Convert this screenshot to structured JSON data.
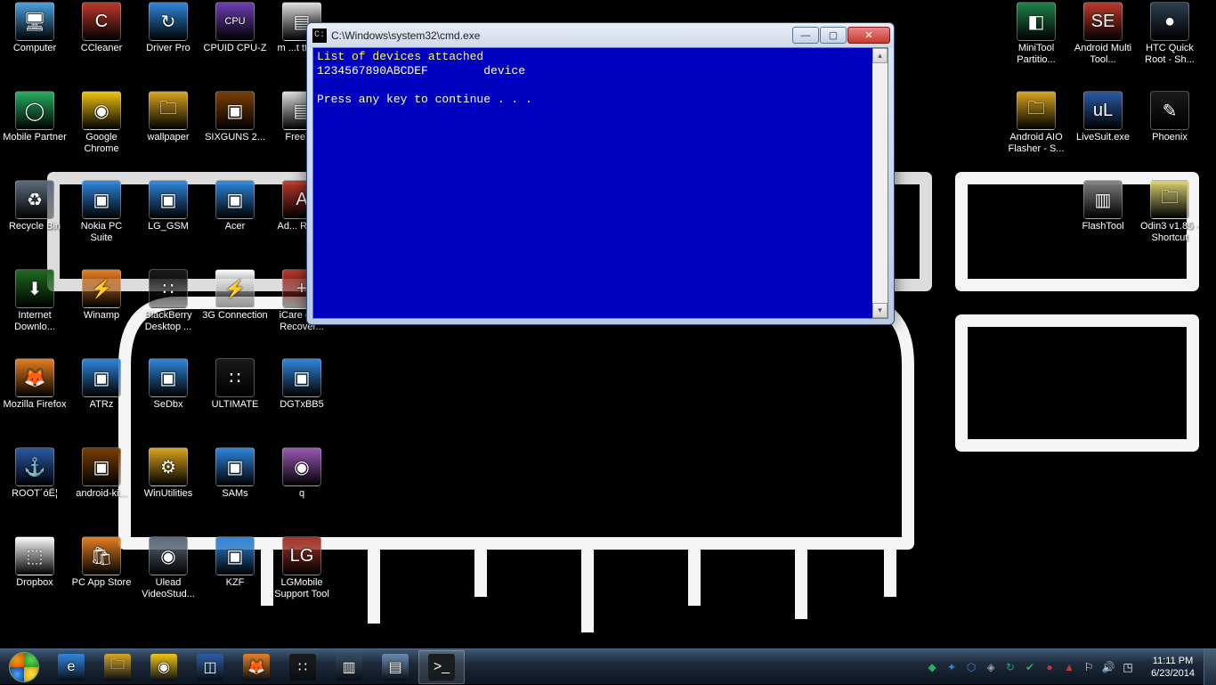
{
  "cmd": {
    "title": "C:\\Windows\\system32\\cmd.exe",
    "line1": "List of devices attached",
    "line2": "1234567890ABCDEF        device",
    "line3": "",
    "line4": "Press any key to continue . . ."
  },
  "desktop_icons": [
    {
      "label": "Computer",
      "glyph": "🖥",
      "col": 0,
      "row": 0,
      "bg": "#4aa3df"
    },
    {
      "label": "CCleaner",
      "glyph": "C",
      "col": 1,
      "row": 0,
      "bg": "#c0392b"
    },
    {
      "label": "Driver Pro",
      "glyph": "↻",
      "col": 2,
      "row": 0,
      "bg": "#2e86de"
    },
    {
      "label": "CPUID CPU-Z",
      "glyph": "CPU",
      "col": 3,
      "row": 0,
      "bg": "#6c3fb5"
    },
    {
      "label": "m ...t tttt t...",
      "glyph": "▤",
      "col": 4,
      "row": 0,
      "bg": "#e0e0e0"
    },
    {
      "label": "MiniTool Partitio...",
      "glyph": "◧",
      "col": 15,
      "row": 0,
      "bg": "#1e8449"
    },
    {
      "label": "Android Multi Tool...",
      "glyph": "SE",
      "col": 16,
      "row": 0,
      "bg": "#c0392b"
    },
    {
      "label": "HTC Quick Root - Sh...",
      "glyph": "●",
      "col": 17,
      "row": 0,
      "bg": "#2c3e50"
    },
    {
      "label": "Mobile Partner",
      "glyph": "◯",
      "col": 0,
      "row": 1,
      "bg": "#27ae60"
    },
    {
      "label": "Google Chrome",
      "glyph": "◉",
      "col": 1,
      "row": 1,
      "bg": "#f1c40f"
    },
    {
      "label": "wallpaper",
      "glyph": "🗀",
      "col": 2,
      "row": 1,
      "bg": "#d9a420"
    },
    {
      "label": "SIXGUNS 2...",
      "glyph": "▣",
      "col": 3,
      "row": 1,
      "bg": "#7b3f00"
    },
    {
      "label": "FreeT...",
      "glyph": "▤",
      "col": 4,
      "row": 1,
      "bg": "#e0e0e0"
    },
    {
      "label": "Android AIO Flasher - S...",
      "glyph": "🗀",
      "col": 15,
      "row": 1,
      "bg": "#d9a420"
    },
    {
      "label": "LiveSuit.exe",
      "glyph": "uL",
      "col": 16,
      "row": 1,
      "bg": "#2b5aa5"
    },
    {
      "label": "Phoenix",
      "glyph": "✎",
      "col": 17,
      "row": 1,
      "bg": "#1a1a1a"
    },
    {
      "label": "Recycle Bin",
      "glyph": "♻",
      "col": 0,
      "row": 2,
      "bg": "#5d6d7e"
    },
    {
      "label": "Nokia PC Suite",
      "glyph": "▣",
      "col": 1,
      "row": 2,
      "bg": "#2e86de"
    },
    {
      "label": "LG_GSM",
      "glyph": "▣",
      "col": 2,
      "row": 2,
      "bg": "#2e86de"
    },
    {
      "label": "Acer",
      "glyph": "▣",
      "col": 3,
      "row": 2,
      "bg": "#2e86de"
    },
    {
      "label": "Ad... Rea...",
      "glyph": "A",
      "col": 4,
      "row": 2,
      "bg": "#c0392b"
    },
    {
      "label": "FlashTool",
      "glyph": "▥",
      "col": 16,
      "row": 2,
      "bg": "#808080"
    },
    {
      "label": "Odin3 v1.85 - Shortcut",
      "glyph": "🗀",
      "col": 17,
      "row": 2,
      "bg": "#d9cf6f"
    },
    {
      "label": "Internet Downlo...",
      "glyph": "⬇",
      "col": 0,
      "row": 3,
      "bg": "#1f6a1f"
    },
    {
      "label": "Winamp",
      "glyph": "⚡",
      "col": 1,
      "row": 3,
      "bg": "#e67e22"
    },
    {
      "label": "BlackBerry Desktop ...",
      "glyph": "∷",
      "col": 2,
      "row": 3,
      "bg": "#1a1a1a"
    },
    {
      "label": "3G Connection",
      "glyph": "⚡",
      "col": 3,
      "row": 3,
      "bg": "#ffffff"
    },
    {
      "label": "iCare data Recover...",
      "glyph": "+",
      "col": 4,
      "row": 3,
      "bg": "#c0392b"
    },
    {
      "label": "Mozilla Firefox",
      "glyph": "🦊",
      "col": 0,
      "row": 4,
      "bg": "#e67e22"
    },
    {
      "label": "ATRz",
      "glyph": "▣",
      "col": 1,
      "row": 4,
      "bg": "#2e86de"
    },
    {
      "label": "SeDbx",
      "glyph": "▣",
      "col": 2,
      "row": 4,
      "bg": "#2e86de"
    },
    {
      "label": "ULTIMATE",
      "glyph": "∷",
      "col": 3,
      "row": 4,
      "bg": "#1a1a1a"
    },
    {
      "label": "DGTxBB5",
      "glyph": "▣",
      "col": 4,
      "row": 4,
      "bg": "#2e86de"
    },
    {
      "label": "ROOT´óÊ¦",
      "glyph": "⚓",
      "col": 0,
      "row": 5,
      "bg": "#2b5aa5"
    },
    {
      "label": "android-ki...",
      "glyph": "▣",
      "col": 1,
      "row": 5,
      "bg": "#7b3f00"
    },
    {
      "label": "WinUtilities",
      "glyph": "⚙",
      "col": 2,
      "row": 5,
      "bg": "#d9a420"
    },
    {
      "label": "SAMs",
      "glyph": "▣",
      "col": 3,
      "row": 5,
      "bg": "#2e86de"
    },
    {
      "label": "q",
      "glyph": "◉",
      "col": 4,
      "row": 5,
      "bg": "#9b59b6"
    },
    {
      "label": "Dropbox",
      "glyph": "⬚",
      "col": 0,
      "row": 6,
      "bg": "#ffffff"
    },
    {
      "label": "PC App Store",
      "glyph": "🛍",
      "col": 1,
      "row": 6,
      "bg": "#e67e22"
    },
    {
      "label": "Ulead VideoStud...",
      "glyph": "◉",
      "col": 2,
      "row": 6,
      "bg": "#5d6d7e"
    },
    {
      "label": "KZF",
      "glyph": "▣",
      "col": 3,
      "row": 6,
      "bg": "#2e86de"
    },
    {
      "label": "LGMobile Support Tool",
      "glyph": "LG",
      "col": 4,
      "row": 6,
      "bg": "#a93226"
    }
  ],
  "taskbar": {
    "items": [
      {
        "glyph": "e",
        "bg": "#2e86de",
        "name": "ie"
      },
      {
        "glyph": "🗀",
        "bg": "#d9a420",
        "name": "explorer"
      },
      {
        "glyph": "◉",
        "bg": "#f1c40f",
        "name": "chrome"
      },
      {
        "glyph": "◫",
        "bg": "#2b5aa5",
        "name": "switcher"
      },
      {
        "glyph": "🦊",
        "bg": "#e67e22",
        "name": "firefox"
      },
      {
        "glyph": "∷",
        "bg": "#1a1a1a",
        "name": "blackberry"
      },
      {
        "glyph": "▥",
        "bg": "#34495e",
        "name": "app1"
      },
      {
        "glyph": "▤",
        "bg": "#6a8aaf",
        "name": "app2"
      },
      {
        "glyph": ">_",
        "bg": "#1a1a1a",
        "name": "cmd",
        "active": true
      }
    ],
    "tray": [
      "◆",
      "✦",
      "⬡",
      "◈",
      "↻",
      "✔",
      "●",
      "▲",
      "⚐",
      "🔊",
      "◳"
    ],
    "time": "11:11 PM",
    "date": "6/23/2014"
  }
}
